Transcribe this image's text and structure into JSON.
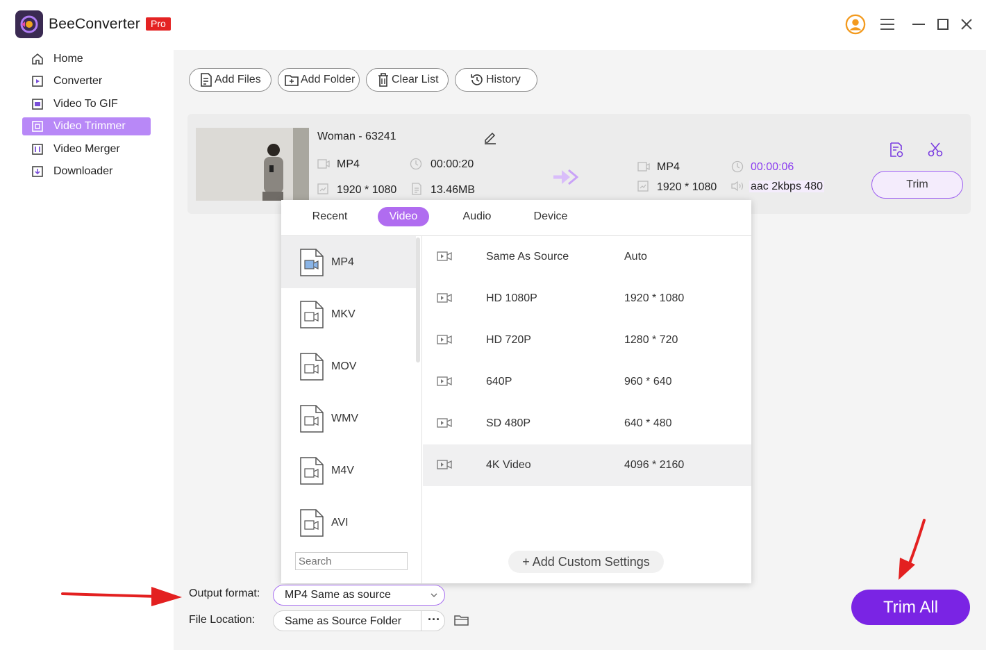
{
  "app": {
    "name": "BeeConverter",
    "badge": "Pro"
  },
  "sidebar": {
    "items": [
      {
        "label": "Home",
        "icon": "home-icon",
        "active": false
      },
      {
        "label": "Converter",
        "icon": "converter-icon",
        "active": false
      },
      {
        "label": "Video To GIF",
        "icon": "gif-icon",
        "active": false
      },
      {
        "label": "Video Trimmer",
        "icon": "trimmer-icon",
        "active": true
      },
      {
        "label": "Video Merger",
        "icon": "merger-icon",
        "active": false
      },
      {
        "label": "Downloader",
        "icon": "download-icon",
        "active": false
      }
    ]
  },
  "toolbar": {
    "add_files": "Add Files",
    "add_folder": "Add Folder",
    "clear_list": "Clear List",
    "history": "History"
  },
  "file": {
    "name": "Woman - 63241",
    "source": {
      "format": "MP4",
      "duration": "00:00:20",
      "resolution": "1920 * 1080",
      "size": "13.46MB"
    },
    "output": {
      "format": "MP4",
      "duration": "00:00:06",
      "resolution": "1920 * 1080",
      "audio": "aac 2kbps 480"
    },
    "trim_label": "Trim"
  },
  "format_popup": {
    "tabs": [
      "Recent",
      "Video",
      "Audio",
      "Device"
    ],
    "active_tab": "Video",
    "formats": [
      "MP4",
      "MKV",
      "MOV",
      "WMV",
      "M4V",
      "AVI"
    ],
    "selected_format": "MP4",
    "search_placeholder": "Search",
    "presets": [
      {
        "name": "Same As Source",
        "resolution": "Auto"
      },
      {
        "name": "HD 1080P",
        "resolution": "1920 * 1080"
      },
      {
        "name": "HD 720P",
        "resolution": "1280 * 720"
      },
      {
        "name": "640P",
        "resolution": "960 * 640"
      },
      {
        "name": "SD 480P",
        "resolution": "640 * 480"
      },
      {
        "name": "4K Video",
        "resolution": "4096 * 2160"
      }
    ],
    "highlighted_preset": "4K Video",
    "custom_settings": "+ Add Custom Settings"
  },
  "bottom": {
    "output_format_label": "Output format:",
    "output_format_value": "MP4 Same as source",
    "file_location_label": "File Location:",
    "file_location_value": "Same as Source Folder",
    "more_label": "···",
    "trim_all": "Trim All"
  },
  "colors": {
    "accent": "#7a24e4",
    "active_nav": "#b888f7",
    "pro_badge": "#e42323",
    "annotation_arrow": "#e32020"
  }
}
